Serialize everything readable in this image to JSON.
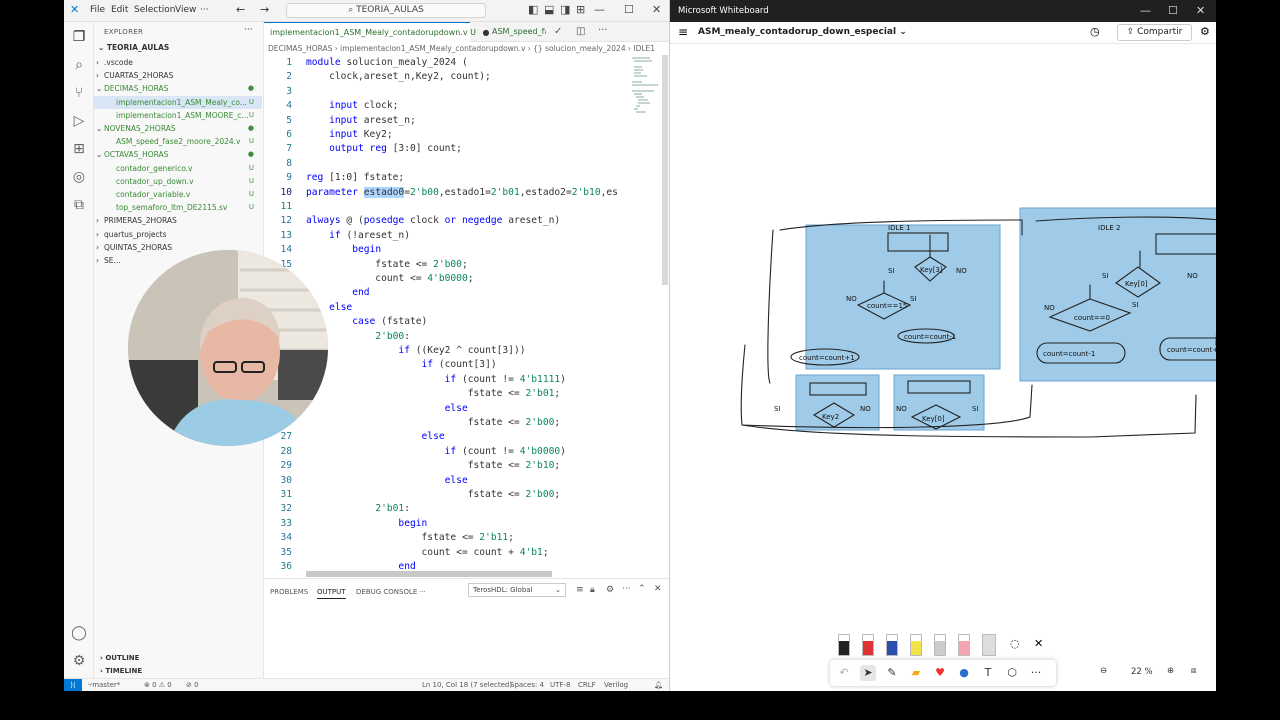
{
  "vscode": {
    "menu": [
      "File",
      "Edit",
      "Selection",
      "View"
    ],
    "search": "TEORIA_AULAS",
    "explorer": {
      "header": "EXPLORER",
      "root": "TEORIA_AULAS",
      "items": [
        {
          "label": ".vscode",
          "indent": 1,
          "arrow": "›",
          "status": ""
        },
        {
          "label": "CUARTAS_2HORAS",
          "indent": 1,
          "arrow": "›",
          "status": ""
        },
        {
          "label": "DECIMAS_HORAS",
          "indent": 1,
          "arrow": "⌄",
          "status": "●"
        },
        {
          "label": "implementacion1_ASM_Mealy_co...",
          "indent": 2,
          "arrow": "",
          "status": "U"
        },
        {
          "label": "implementacion1_ASM_MOORE_c...",
          "indent": 2,
          "arrow": "",
          "status": "U"
        },
        {
          "label": "NOVENAS_2HORAS",
          "indent": 1,
          "arrow": "⌄",
          "status": "●"
        },
        {
          "label": "ASM_speed_fase2_moore_2024.v",
          "indent": 2,
          "arrow": "",
          "status": "U"
        },
        {
          "label": "OCTAVAS_HORAS",
          "indent": 1,
          "arrow": "⌄",
          "status": "●"
        },
        {
          "label": "contador_generico.v",
          "indent": 2,
          "arrow": "",
          "status": "U"
        },
        {
          "label": "contador_up_down.v",
          "indent": 2,
          "arrow": "",
          "status": "U"
        },
        {
          "label": "contador_variable.v",
          "indent": 2,
          "arrow": "",
          "status": "U"
        },
        {
          "label": "top_semaforo_ltm_DE2115.sv",
          "indent": 2,
          "arrow": "",
          "status": "U"
        },
        {
          "label": "PRIMERAS_2HORAS",
          "indent": 1,
          "arrow": "›",
          "status": ""
        },
        {
          "label": "quartus_projects",
          "indent": 1,
          "arrow": "›",
          "status": ""
        },
        {
          "label": "QUINTAS_2HORAS",
          "indent": 1,
          "arrow": "›",
          "status": ""
        },
        {
          "label": "SE...",
          "indent": 1,
          "arrow": "›",
          "status": ""
        }
      ],
      "outline": "OUTLINE",
      "timeline": "TIMELINE"
    },
    "tabs": [
      {
        "label": "implementacion1_ASM_Mealy_contadorupdown.v  U",
        "dirty": "●"
      },
      {
        "label": "ASM_speed_fa",
        "dirty": ""
      }
    ],
    "breadcrumb": "DECIMAS_HORAS  ›  implementacion1_ASM_Mealy_contadorupdown.v  ›  {} solucion_mealy_2024  ›  IDLE1",
    "code": [
      {
        "n": "1",
        "text": "module solucion_mealy_2024 ("
      },
      {
        "n": "2",
        "text": "    clock,areset_n,Key2, count);"
      },
      {
        "n": "3",
        "text": ""
      },
      {
        "n": "4",
        "text": "    input clock;"
      },
      {
        "n": "5",
        "text": "    input areset_n;"
      },
      {
        "n": "6",
        "text": "    input Key2;"
      },
      {
        "n": "7",
        "text": "    output reg [3:0] count;"
      },
      {
        "n": "8",
        "text": ""
      },
      {
        "n": "9",
        "text": "reg [1:0] fstate;"
      },
      {
        "n": "10",
        "text": "parameter estado0=2'b00,estado1=2'b01,estado2=2'b10,es"
      },
      {
        "n": "11",
        "text": ""
      },
      {
        "n": "12",
        "text": "always @ (posedge clock or negedge areset_n)"
      },
      {
        "n": "13",
        "text": "    if (!areset_n)"
      },
      {
        "n": "14",
        "text": "        begin"
      },
      {
        "n": "15",
        "text": "            fstate <= 2'b00;"
      },
      {
        "n": "16",
        "text": "            count <= 4'b0000;"
      },
      {
        "n": "17",
        "text": "        end"
      },
      {
        "n": "18",
        "text": "    else"
      },
      {
        "n": "19",
        "text": "        case (fstate)"
      },
      {
        "n": "20",
        "text": "            2'b00:"
      },
      {
        "n": "21",
        "text": "                if ((Key2 ^ count[3]))"
      },
      {
        "n": "22",
        "text": "                    if (count[3])"
      },
      {
        "n": "23",
        "text": "                        if (count != 4'b1111)"
      },
      {
        "n": "24",
        "text": "                            fstate <= 2'b01;"
      },
      {
        "n": "25",
        "text": "                        else"
      },
      {
        "n": "26",
        "text": "                            fstate <= 2'b00;"
      },
      {
        "n": "27",
        "text": "                    else"
      },
      {
        "n": "28",
        "text": "                        if (count != 4'b0000)"
      },
      {
        "n": "29",
        "text": "                            fstate <= 2'b10;"
      },
      {
        "n": "30",
        "text": "                        else"
      },
      {
        "n": "31",
        "text": "                            fstate <= 2'b00;"
      },
      {
        "n": "32",
        "text": "            2'b01:"
      },
      {
        "n": "33",
        "text": "                begin"
      },
      {
        "n": "34",
        "text": "                    fstate <= 2'b11;"
      },
      {
        "n": "35",
        "text": "                    count <= count + 4'b1;"
      },
      {
        "n": "36",
        "text": "                end"
      }
    ],
    "panel": {
      "tabs": [
        "PROBLEMS",
        "OUTPUT",
        "DEBUG CONSOLE",
        "···"
      ],
      "active_tab": "OUTPUT",
      "select": "TerosHDL: Global"
    },
    "status": {
      "branch": "master*",
      "errors": "⊗ 0  ⚠ 0",
      "ports": "⊘ 0",
      "position": "Ln 10, Col 18 (7 selected)",
      "spaces": "Spaces: 4",
      "encoding": "UTF-8",
      "eol": "CRLF",
      "language": "Verilog"
    }
  },
  "whiteboard": {
    "app_title": "Microsoft Whiteboard",
    "doc_title": "ASM_mealy_contadorup_down_especial",
    "share": "Compartir",
    "zoom": "22 %",
    "sketch_labels": {
      "idle1": "IDLE 1",
      "idle2": "IDLE 2",
      "key3": "Key[3]",
      "key0": "Key[0]",
      "si": "SI",
      "no": "NO",
      "count_eq_0": "count==0",
      "count_eq_15": "count==15",
      "count_minus": "count=count-1",
      "count_plus": "count=count+1",
      "key2": "Key2"
    }
  }
}
